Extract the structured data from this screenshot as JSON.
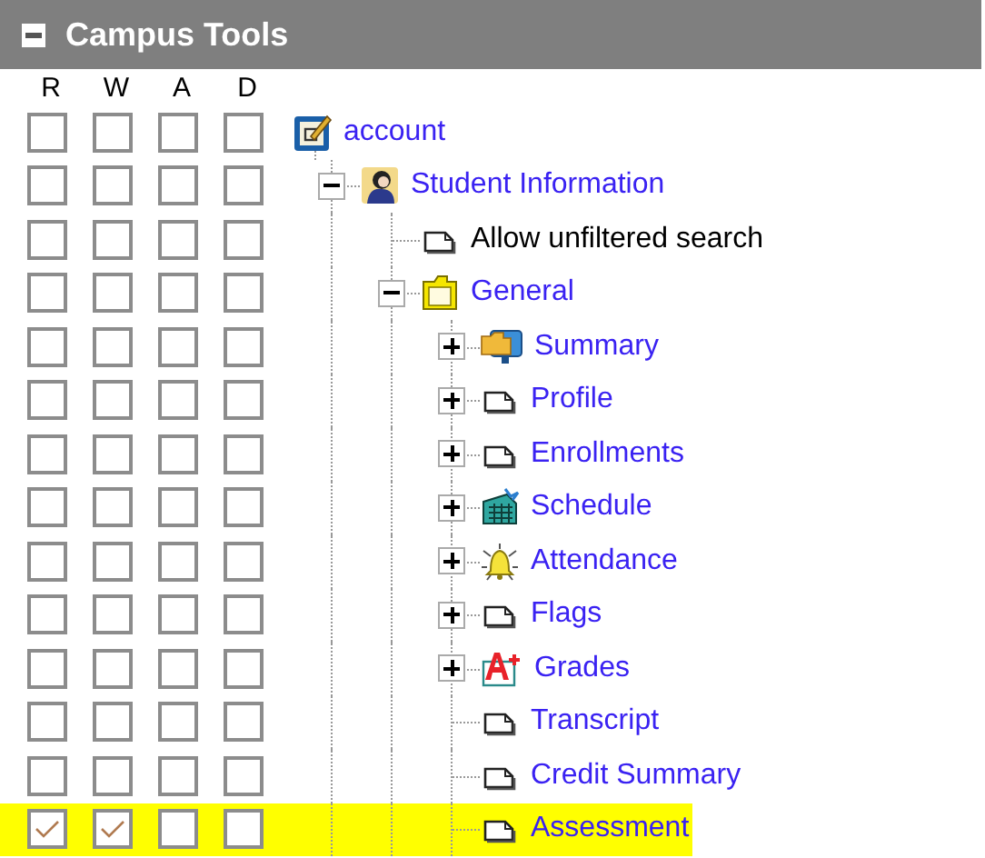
{
  "panel": {
    "title": "Campus Tools",
    "collapsed": false
  },
  "columns": [
    "R",
    "W",
    "A",
    "D"
  ],
  "tree": [
    {
      "label": "account",
      "kind": "notepad",
      "link": true,
      "selected": false,
      "permissions": [
        false,
        false,
        false,
        false
      ],
      "children": [
        {
          "label": "Student Information",
          "kind": "person",
          "link": true,
          "selected": false,
          "expanded": true,
          "permissions": [
            false,
            false,
            false,
            false
          ],
          "children": [
            {
              "label": "Allow unfiltered search",
              "kind": "page",
              "link": false,
              "selected": false,
              "permissions": [
                false,
                false,
                false,
                false
              ]
            },
            {
              "label": "General",
              "kind": "folder",
              "link": true,
              "selected": false,
              "expanded": true,
              "permissions": [
                false,
                false,
                false,
                false
              ],
              "children": [
                {
                  "label": "Summary",
                  "kind": "monitor-folder",
                  "link": true,
                  "selected": false,
                  "expanded": false,
                  "permissions": [
                    false,
                    false,
                    false,
                    false
                  ]
                },
                {
                  "label": "Profile",
                  "kind": "page",
                  "link": true,
                  "selected": false,
                  "expanded": false,
                  "permissions": [
                    false,
                    false,
                    false,
                    false
                  ]
                },
                {
                  "label": "Enrollments",
                  "kind": "page",
                  "link": true,
                  "selected": false,
                  "expanded": false,
                  "permissions": [
                    false,
                    false,
                    false,
                    false
                  ]
                },
                {
                  "label": "Schedule",
                  "kind": "calendar",
                  "link": true,
                  "selected": false,
                  "expanded": false,
                  "permissions": [
                    false,
                    false,
                    false,
                    false
                  ]
                },
                {
                  "label": "Attendance",
                  "kind": "bell",
                  "link": true,
                  "selected": false,
                  "expanded": false,
                  "permissions": [
                    false,
                    false,
                    false,
                    false
                  ]
                },
                {
                  "label": "Flags",
                  "kind": "page",
                  "link": true,
                  "selected": false,
                  "expanded": false,
                  "permissions": [
                    false,
                    false,
                    false,
                    false
                  ]
                },
                {
                  "label": "Grades",
                  "kind": "grade",
                  "link": true,
                  "selected": false,
                  "expanded": false,
                  "permissions": [
                    false,
                    false,
                    false,
                    false
                  ]
                },
                {
                  "label": "Transcript",
                  "kind": "page",
                  "link": true,
                  "selected": false,
                  "permissions": [
                    false,
                    false,
                    false,
                    false
                  ]
                },
                {
                  "label": "Credit Summary",
                  "kind": "page",
                  "link": true,
                  "selected": false,
                  "permissions": [
                    false,
                    false,
                    false,
                    false
                  ]
                },
                {
                  "label": "Assessment",
                  "kind": "page",
                  "link": true,
                  "selected": true,
                  "permissions": [
                    true,
                    true,
                    false,
                    false
                  ]
                }
              ]
            }
          ]
        }
      ]
    }
  ]
}
